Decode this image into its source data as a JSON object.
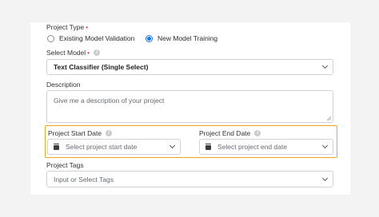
{
  "project_type": {
    "label": "Project Type",
    "required_mark": "•",
    "options": [
      {
        "label": "Existing Model Validation",
        "checked": false
      },
      {
        "label": "New Model Training",
        "checked": true
      }
    ]
  },
  "select_model": {
    "label": "Select Model",
    "required_mark": "•",
    "info_glyph": "i",
    "value": "Text Classifier (Single Select)"
  },
  "description": {
    "label": "Description",
    "placeholder": "Give me a description of your project"
  },
  "start_date": {
    "label": "Project Start Date",
    "info_glyph": "i",
    "placeholder": "Select project start date"
  },
  "end_date": {
    "label": "Project End Date",
    "info_glyph": "i",
    "placeholder": "Select project end date"
  },
  "tags": {
    "label": "Project Tags",
    "placeholder": "Input or Select Tags"
  },
  "colors": {
    "accent": "#1a73e8",
    "highlight": "#f5a524",
    "required": "#d9364d"
  }
}
